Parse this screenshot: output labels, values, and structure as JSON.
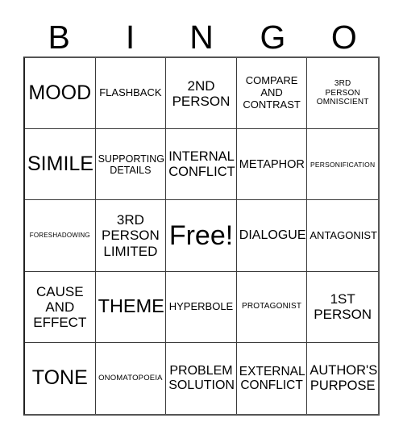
{
  "card": {
    "header_letters": [
      "B",
      "I",
      "N",
      "G",
      "O"
    ],
    "columns": 5,
    "rows": 5,
    "free_space_index": 12,
    "background_color": "#ffffff",
    "text_color": "#000000",
    "border_color": "#3a3a3a",
    "outer_border_color": "#555555"
  },
  "cells": [
    {
      "text": "MOOD",
      "size": "lg"
    },
    {
      "text": "FLASHBACK",
      "size": "sm"
    },
    {
      "text": "2ND\nPERSON",
      "size": "md"
    },
    {
      "text": "COMPARE\nAND\nCONTRAST",
      "size": "sm"
    },
    {
      "text": "3RD\nPERSON\nOMNISCIENT",
      "size": "xs"
    },
    {
      "text": "SIMILE",
      "size": "lg"
    },
    {
      "text": "SUPPORTING\nDETAILS",
      "size": "sm"
    },
    {
      "text": "INTERNAL\nCONFLICT",
      "size": "md"
    },
    {
      "text": "METAPHOR",
      "size": "md"
    },
    {
      "text": "PERSONIFICATION",
      "size": "xs"
    },
    {
      "text": "FORESHADOWING",
      "size": "xxs"
    },
    {
      "text": "3RD\nPERSON\nLIMITED",
      "size": "md"
    },
    {
      "text": "Free!",
      "size": "xl"
    },
    {
      "text": "DIALOGUE",
      "size": "md"
    },
    {
      "text": "ANTAGONIST",
      "size": "sm"
    },
    {
      "text": "CAUSE\nAND\nEFFECT",
      "size": "md"
    },
    {
      "text": "THEME",
      "size": "lg"
    },
    {
      "text": "HYPERBOLE",
      "size": "sm"
    },
    {
      "text": "PROTAGONIST",
      "size": "xs"
    },
    {
      "text": "1ST\nPERSON",
      "size": "md"
    },
    {
      "text": "TONE",
      "size": "lg"
    },
    {
      "text": "ONOMATOPOEIA",
      "size": "xs"
    },
    {
      "text": "PROBLEM\nSOLUTION",
      "size": "md"
    },
    {
      "text": "EXTERNAL\nCONFLICT",
      "size": "md"
    },
    {
      "text": "AUTHOR'S\nPURPOSE",
      "size": "md"
    }
  ]
}
